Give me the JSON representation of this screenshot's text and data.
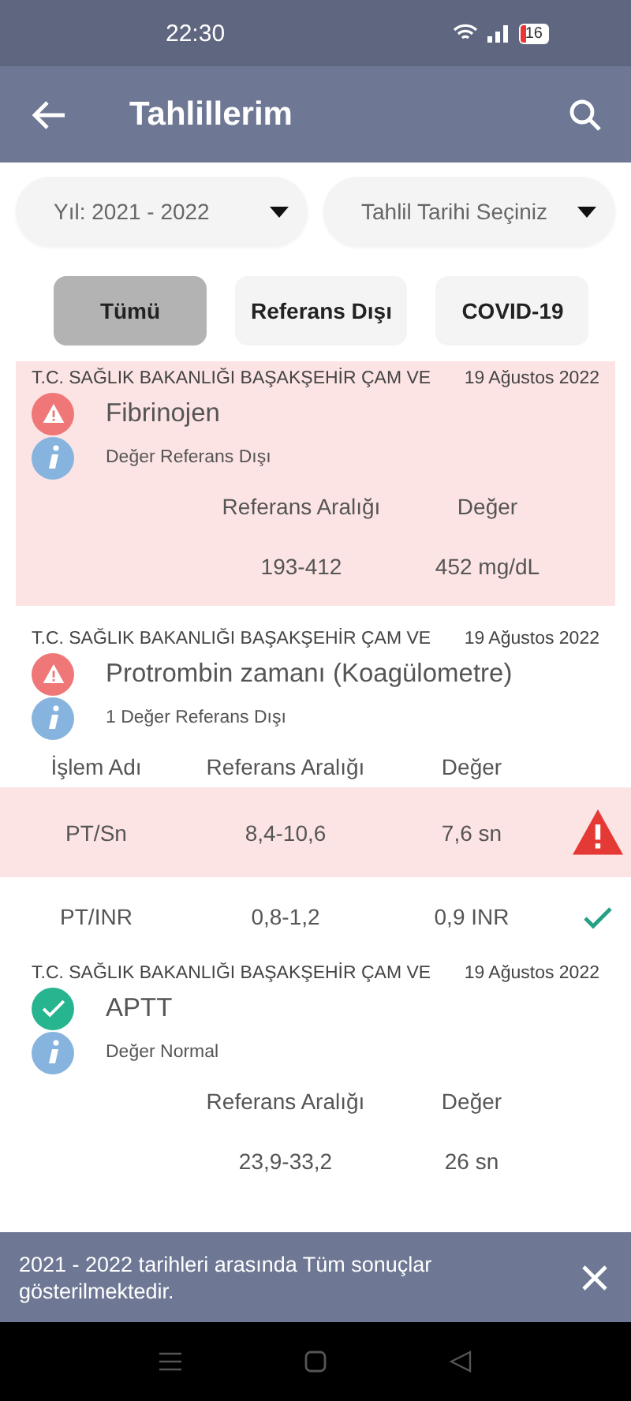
{
  "status_bar": {
    "time": "22:30",
    "battery": "16"
  },
  "app_bar": {
    "title": "Tahlillerim"
  },
  "filters": [
    {
      "label": "Yıl: 2021 - 2022"
    },
    {
      "label": "Tahlil Tarihi Seçiniz"
    }
  ],
  "chips": [
    {
      "label": "Tümü",
      "selected": true
    },
    {
      "label": "Referans Dışı",
      "selected": false
    },
    {
      "label": "COVID-19",
      "selected": false
    }
  ],
  "results": [
    {
      "normal": false,
      "highlighted": true,
      "institution": "T.C. SAĞLIK BAKANLIĞI BAŞAKŞEHİR ÇAM VE",
      "date": "19 Ağustos 2022",
      "test": "Fibrinojen",
      "note": "Değer Referans Dışı",
      "columns": {
        "range": "Referans Aralığı",
        "value": "Değer"
      },
      "rows": [
        {
          "range": "193-412",
          "value": "452 mg/dL"
        }
      ]
    },
    {
      "normal": false,
      "highlighted": false,
      "institution": "T.C. SAĞLIK BAKANLIĞI BAŞAKŞEHİR ÇAM VE",
      "date": "19 Ağustos 2022",
      "test": "Protrombin zamanı (Koagülometre)",
      "note": "1 Değer Referans Dışı",
      "columns": {
        "name": "İşlem Adı",
        "range": "Referans Aralığı",
        "value": "Değer"
      },
      "rows": [
        {
          "name": "PT/Sn",
          "range": "8,4-10,6",
          "value": "7,6 sn",
          "out_of_range": true
        },
        {
          "name": "PT/INR",
          "range": "0,8-1,2",
          "value": "0,9 INR",
          "out_of_range": false
        }
      ]
    },
    {
      "normal": true,
      "highlighted": false,
      "institution": "T.C. SAĞLIK BAKANLIĞI BAŞAKŞEHİR ÇAM VE",
      "date": "19 Ağustos 2022",
      "test": "APTT",
      "note": "Değer Normal",
      "columns": {
        "range": "Referans Aralığı",
        "value": "Değer"
      },
      "rows": [
        {
          "range": "23,9-33,2",
          "value": "26 sn"
        }
      ]
    }
  ],
  "snackbar": {
    "message": "2021 - 2022 tarihleri arasında Tüm sonuçlar gösterilmektedir."
  }
}
